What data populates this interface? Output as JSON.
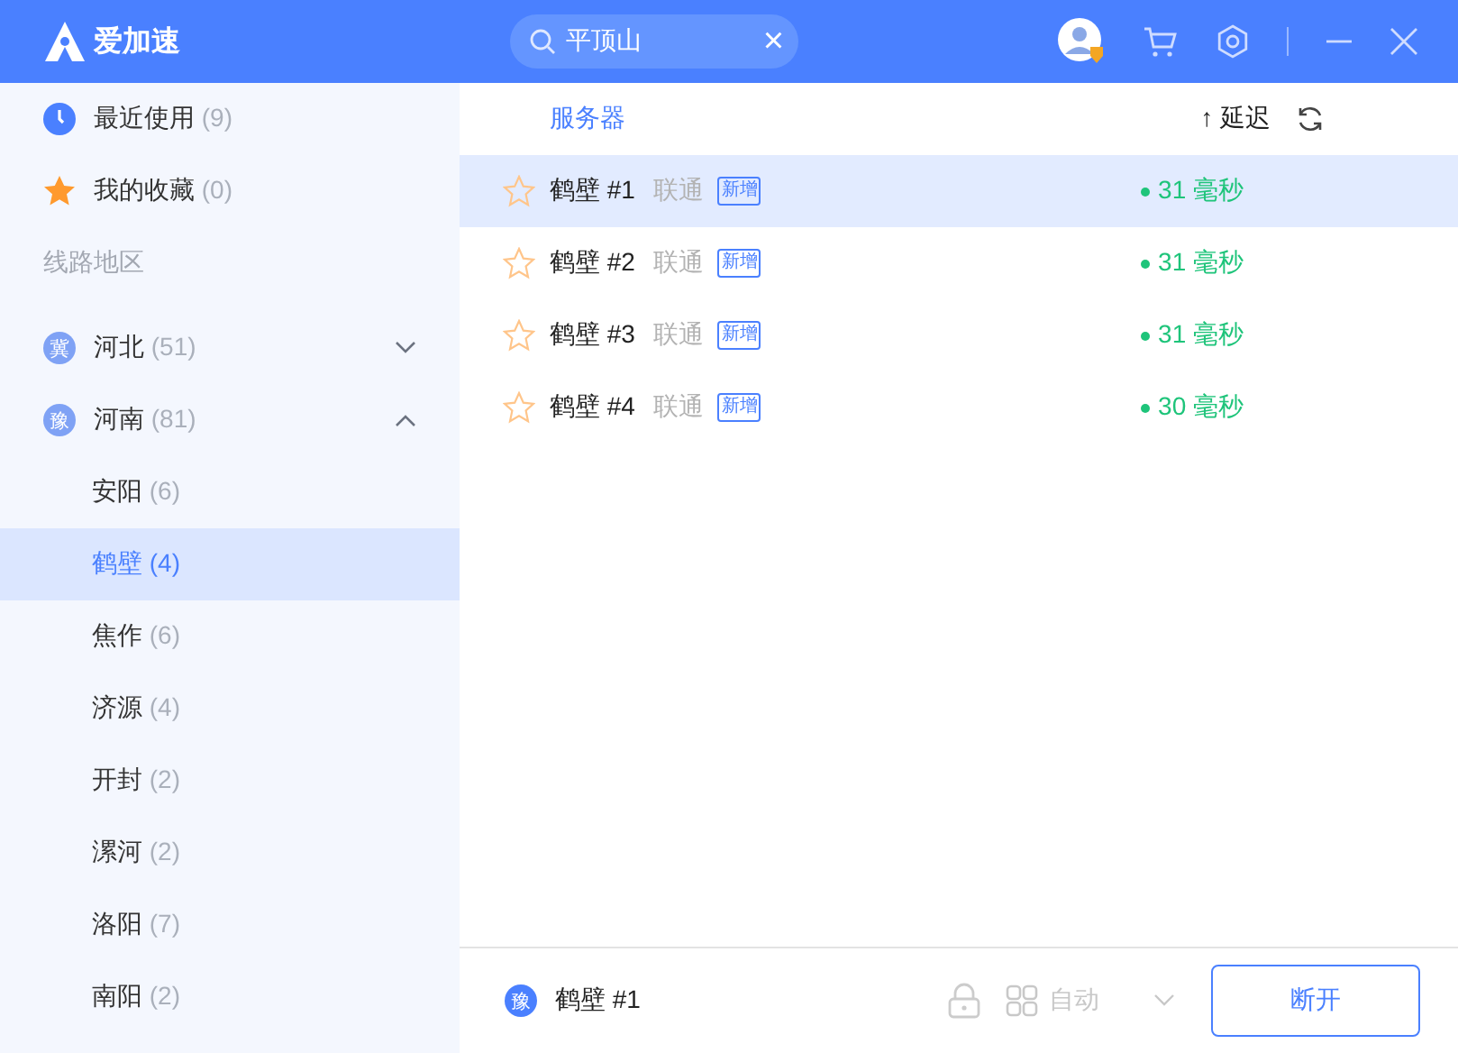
{
  "app": {
    "name": "爱加速"
  },
  "search": {
    "value": "平顶山",
    "clear": "×"
  },
  "sidebar": {
    "quick": [
      {
        "kind": "recent",
        "label": "最近使用",
        "count": "(9)"
      },
      {
        "kind": "favorites",
        "label": "我的收藏",
        "count": "(0)"
      }
    ],
    "section": "线路地区",
    "regions": [
      {
        "badge": "冀",
        "label": "河北",
        "count": "(51)",
        "expanded": false
      },
      {
        "badge": "豫",
        "label": "河南",
        "count": "(81)",
        "expanded": true,
        "children": [
          {
            "label": "安阳",
            "count": "(6)",
            "selected": false
          },
          {
            "label": "鹤壁",
            "count": "(4)",
            "selected": true
          },
          {
            "label": "焦作",
            "count": "(6)",
            "selected": false
          },
          {
            "label": "济源",
            "count": "(4)",
            "selected": false
          },
          {
            "label": "开封",
            "count": "(2)",
            "selected": false
          },
          {
            "label": "漯河",
            "count": "(2)",
            "selected": false
          },
          {
            "label": "洛阳",
            "count": "(7)",
            "selected": false
          },
          {
            "label": "南阳",
            "count": "(2)",
            "selected": false
          }
        ]
      }
    ]
  },
  "table": {
    "columns": [
      "服务器",
      "延迟"
    ],
    "sort_arrow": "↑",
    "rows": [
      {
        "name": "鹤壁 #1",
        "isp": "联通",
        "tag": "新增",
        "latency": "31 毫秒",
        "favorite": false,
        "selected": true
      },
      {
        "name": "鹤壁 #2",
        "isp": "联通",
        "tag": "新增",
        "latency": "31 毫秒",
        "favorite": false,
        "selected": false
      },
      {
        "name": "鹤壁 #3",
        "isp": "联通",
        "tag": "新增",
        "latency": "31 毫秒",
        "favorite": false,
        "selected": false
      },
      {
        "name": "鹤壁 #4",
        "isp": "联通",
        "tag": "新增",
        "latency": "30 毫秒",
        "favorite": false,
        "selected": false
      }
    ]
  },
  "footer": {
    "badge": "豫",
    "server": "鹤壁 #1",
    "mode": "自动",
    "mode_disabled": true,
    "button": "断开"
  }
}
